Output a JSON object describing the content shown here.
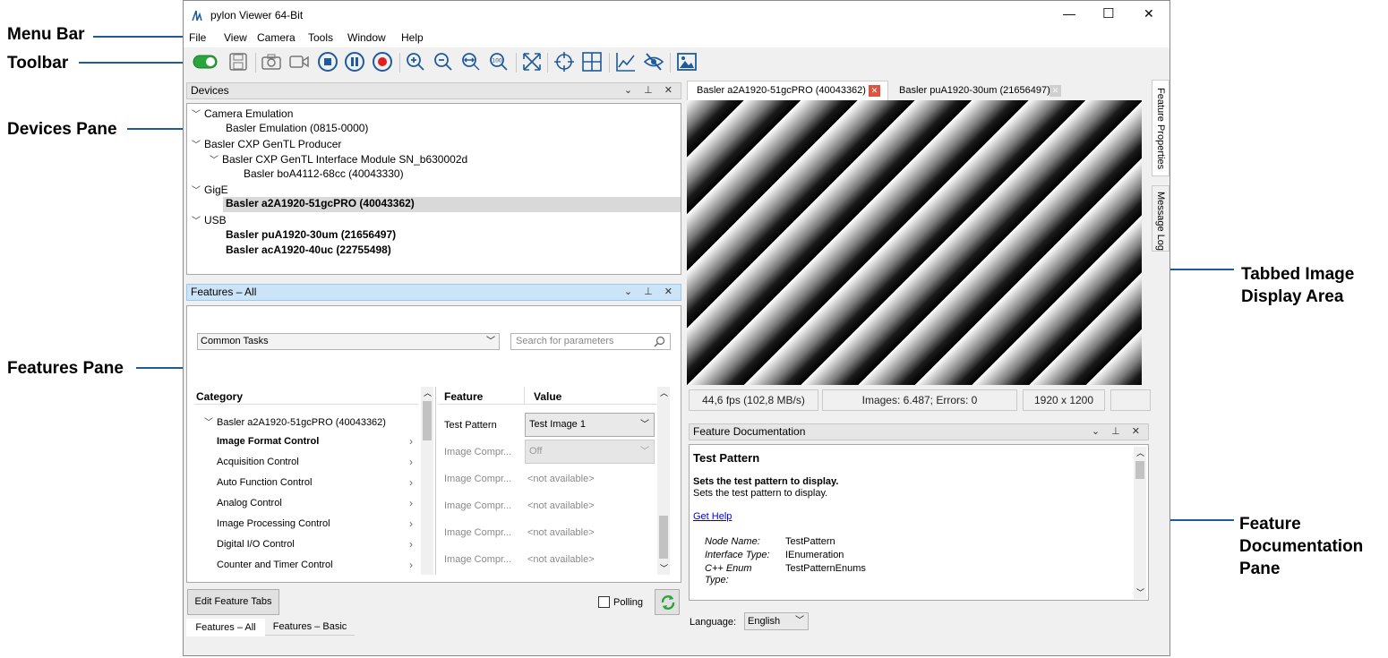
{
  "callouts": {
    "menu_bar": "Menu Bar",
    "toolbar": "Toolbar",
    "devices_pane": "Devices Pane",
    "features_pane": "Features Pane",
    "tabbed_image_1": "Tabbed Image",
    "tabbed_image_2": "Display Area",
    "feature_doc_1": "Feature",
    "feature_doc_2": "Documentation",
    "feature_doc_3": "Pane"
  },
  "window": {
    "title": "pylon Viewer 64-Bit",
    "controls": {
      "minimize": "—",
      "maximize": "☐",
      "close": "✕"
    }
  },
  "menu": [
    "File",
    "View",
    "Camera",
    "Tools",
    "Window",
    "Help"
  ],
  "toolbar_icons": [
    "toggle-icon",
    "save-icon",
    "camera-snapshot-icon",
    "video-camera-icon",
    "stop-icon",
    "pause-icon",
    "record-icon",
    "zoom-in-icon",
    "zoom-out-icon",
    "zoom-fit-icon",
    "zoom-100-icon",
    "fullscreen-icon",
    "crosshair-icon",
    "grid-icon",
    "chart-icon",
    "hide-icon",
    "image-icon"
  ],
  "devices": {
    "title": "Devices",
    "items": [
      {
        "label": "Camera Emulation",
        "level": 0,
        "chev": "v"
      },
      {
        "label": "Basler Emulation (0815-0000)",
        "level": 1
      },
      {
        "label": "Basler CXP GenTL Producer",
        "level": 0,
        "chev": "v"
      },
      {
        "label": "Basler CXP GenTL Interface Module SN_b630002d",
        "level": 1,
        "chev": "v"
      },
      {
        "label": "Basler boA4112-68cc (40043330)",
        "level": 2
      },
      {
        "label": "GigE",
        "level": 0,
        "chev": "v"
      },
      {
        "label": "Basler a2A1920-51gcPRO (40043362)",
        "level": 1,
        "bold": true,
        "selected": true
      },
      {
        "label": "USB",
        "level": 0,
        "chev": "v"
      },
      {
        "label": "Basler puA1920-30um (21656497)",
        "level": 1,
        "bold": true
      },
      {
        "label": "Basler acA1920-40uc (22755498)",
        "level": 1,
        "bold": true
      }
    ]
  },
  "features": {
    "title": "Features – All",
    "dropdown": "Common Tasks",
    "search_placeholder": "Search for parameters",
    "col_category": "Category",
    "col_feature": "Feature",
    "col_value": "Value",
    "camera_node": "Basler a2A1920-51gcPRO (40043362)",
    "categories": [
      "Image Format Control",
      "Acquisition Control",
      "Auto Function Control",
      "Analog Control",
      "Image Processing Control",
      "Digital I/O Control",
      "Counter and Timer Control"
    ],
    "rows": [
      {
        "feature": "Test Pattern",
        "value": "Test Image 1"
      },
      {
        "feature": "Image Compr...",
        "value": "Off"
      },
      {
        "feature": "Image Compr...",
        "value": "<not available>"
      },
      {
        "feature": "Image Compr...",
        "value": "<not available>"
      },
      {
        "feature": "Image Compr...",
        "value": "<not available>"
      },
      {
        "feature": "Image Compr...",
        "value": "<not available>"
      }
    ],
    "edit_button": "Edit Feature Tabs",
    "polling": "Polling",
    "tabs": [
      "Features – All",
      "Features – Basic"
    ]
  },
  "image_tabs": [
    "Basler a2A1920-51gcPRO (40043362)",
    "Basler puA1920-30um (21656497)"
  ],
  "side_tabs": [
    "Feature Properties",
    "Message Log"
  ],
  "status": {
    "fps": "44,6 fps (102,8 MB/s)",
    "images": "Images: 6.487; Errors: 0",
    "resolution": "1920 x 1200"
  },
  "doc": {
    "title": "Feature Documentation",
    "heading": "Test Pattern",
    "subheading": "Sets the test pattern to display.",
    "body": "Sets the test pattern to display.",
    "link": "Get Help",
    "node_name_label": "Node Name:",
    "node_name": "TestPattern",
    "interface_label": "Interface Type:",
    "interface": "IEnumeration",
    "enum_label_1": "C++ Enum",
    "enum_label_2": "Type:",
    "enum_value": "TestPatternEnums"
  },
  "language": {
    "label": "Language:",
    "value": "English"
  }
}
